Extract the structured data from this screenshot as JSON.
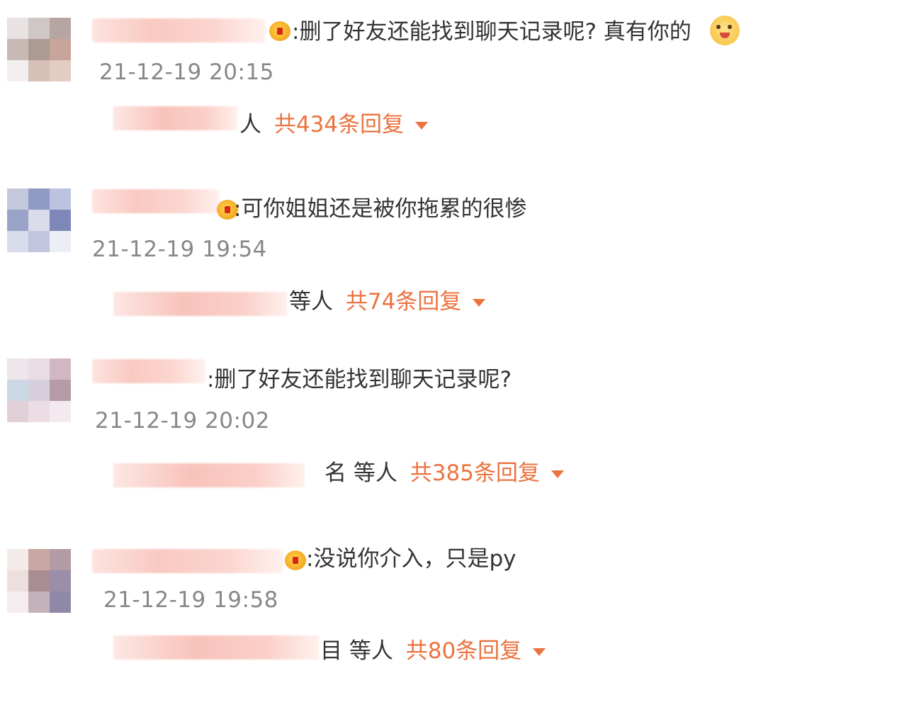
{
  "comments": [
    {
      "text": ":删了好友还能找到聊天记录呢? 真有你的",
      "time": "21-12-19 20:15",
      "reply_who": "人",
      "reply_count": "共434条回复",
      "emoji": "doge-emoji"
    },
    {
      "text": ":可你姐姐还是被你拖累的很惨",
      "time": "21-12-19 19:54",
      "reply_who": "等人",
      "reply_count": "共74条回复"
    },
    {
      "text": ":删了好友还能找到聊天记录呢?",
      "time": "21-12-19 20:02",
      "reply_who": "名 等人",
      "reply_count": "共385条回复"
    },
    {
      "text": ":没说你介入，只是py",
      "time": "21-12-19 19:58",
      "reply_who": "目 等人",
      "reply_count": "共80条回复"
    }
  ],
  "colors": {
    "reply_accent": "#eb7340",
    "time_gray": "#888888",
    "text_dark": "#333333"
  },
  "icons": {
    "badge": "vip-badge-icon",
    "expand": "triangle-down-icon"
  }
}
